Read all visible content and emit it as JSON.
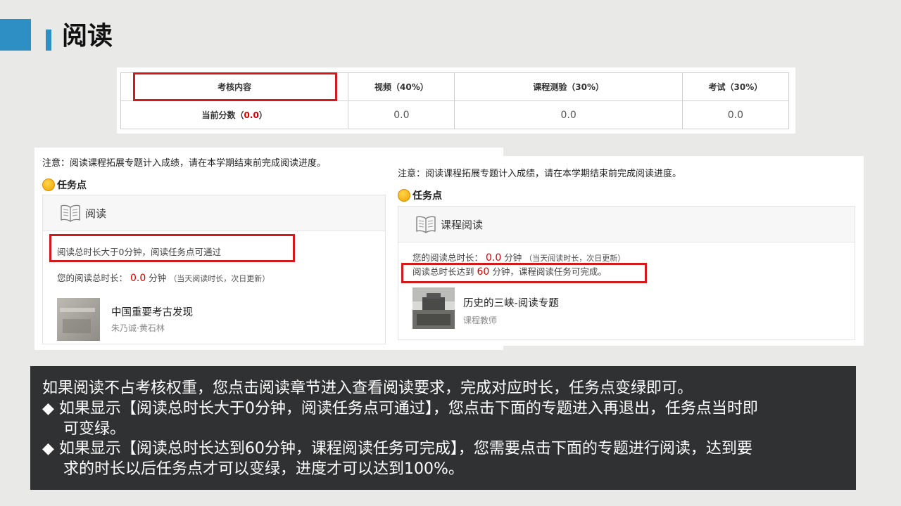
{
  "header": {
    "title": "阅读"
  },
  "score_table": {
    "headers": [
      "考核内容",
      "视频（40%）",
      "课程测验（30%）",
      "考试（30%）"
    ],
    "row_label_prefix": "当前分数（",
    "row_label_value": "0.0",
    "row_label_suffix": "）",
    "values": [
      "0.0",
      "0.0",
      "0.0"
    ]
  },
  "left_panel": {
    "note": "注意：阅读课程拓展专题计入成绩，请在本学期结束前完成阅读进度。",
    "task_label": "任务点",
    "card_title": "阅读",
    "requirement": "阅读总时长大于0分钟，阅读任务点可通过",
    "total_prefix": "您的阅读总时长：",
    "total_value": "0.0",
    "total_unit": "分钟",
    "total_hint": "（当天阅读时长，次日更新）",
    "book_title": "中国重要考古发现",
    "book_author": "朱乃诚·黄石林"
  },
  "right_panel": {
    "note": "注意：阅读课程拓展专题计入成绩，请在本学期结束前完成阅读进度。",
    "task_label": "任务点",
    "card_title": "课程阅读",
    "total_prefix": "您的阅读总时长：",
    "total_value": "0.0",
    "total_unit": "分钟",
    "total_hint": "（当天阅读时长，次日更新）",
    "requirement_prefix": "阅读总时长达到",
    "requirement_value": "60",
    "requirement_suffix": "分钟，课程阅读任务可完成。",
    "book_title": "历史的三峡-阅读专题",
    "book_author": "课程教师"
  },
  "info": {
    "line1": "如果阅读不占考核权重，您点击阅读章节进入查看阅读要求，完成对应时长，任务点变绿即可。",
    "bullet": "◆",
    "b1_line1": "如果显示【阅读总时长大于0分钟，阅读任务点可通过】，您点击下面的专题进入再退出，任务点当时即",
    "b1_line2": "可变绿。",
    "b2_line1": "如果显示【阅读总时长达到60分钟，课程阅读任务可完成】，您需要点击下面的专题进行阅读，达到要",
    "b2_line2": "求的时长以后任务点才可以变绿，进度才可以达到100%。"
  },
  "colors": {
    "accent": "#2e8fc4",
    "highlight_red": "#d11a1a",
    "value_red": "#d40000",
    "info_bg": "#2f3133"
  }
}
